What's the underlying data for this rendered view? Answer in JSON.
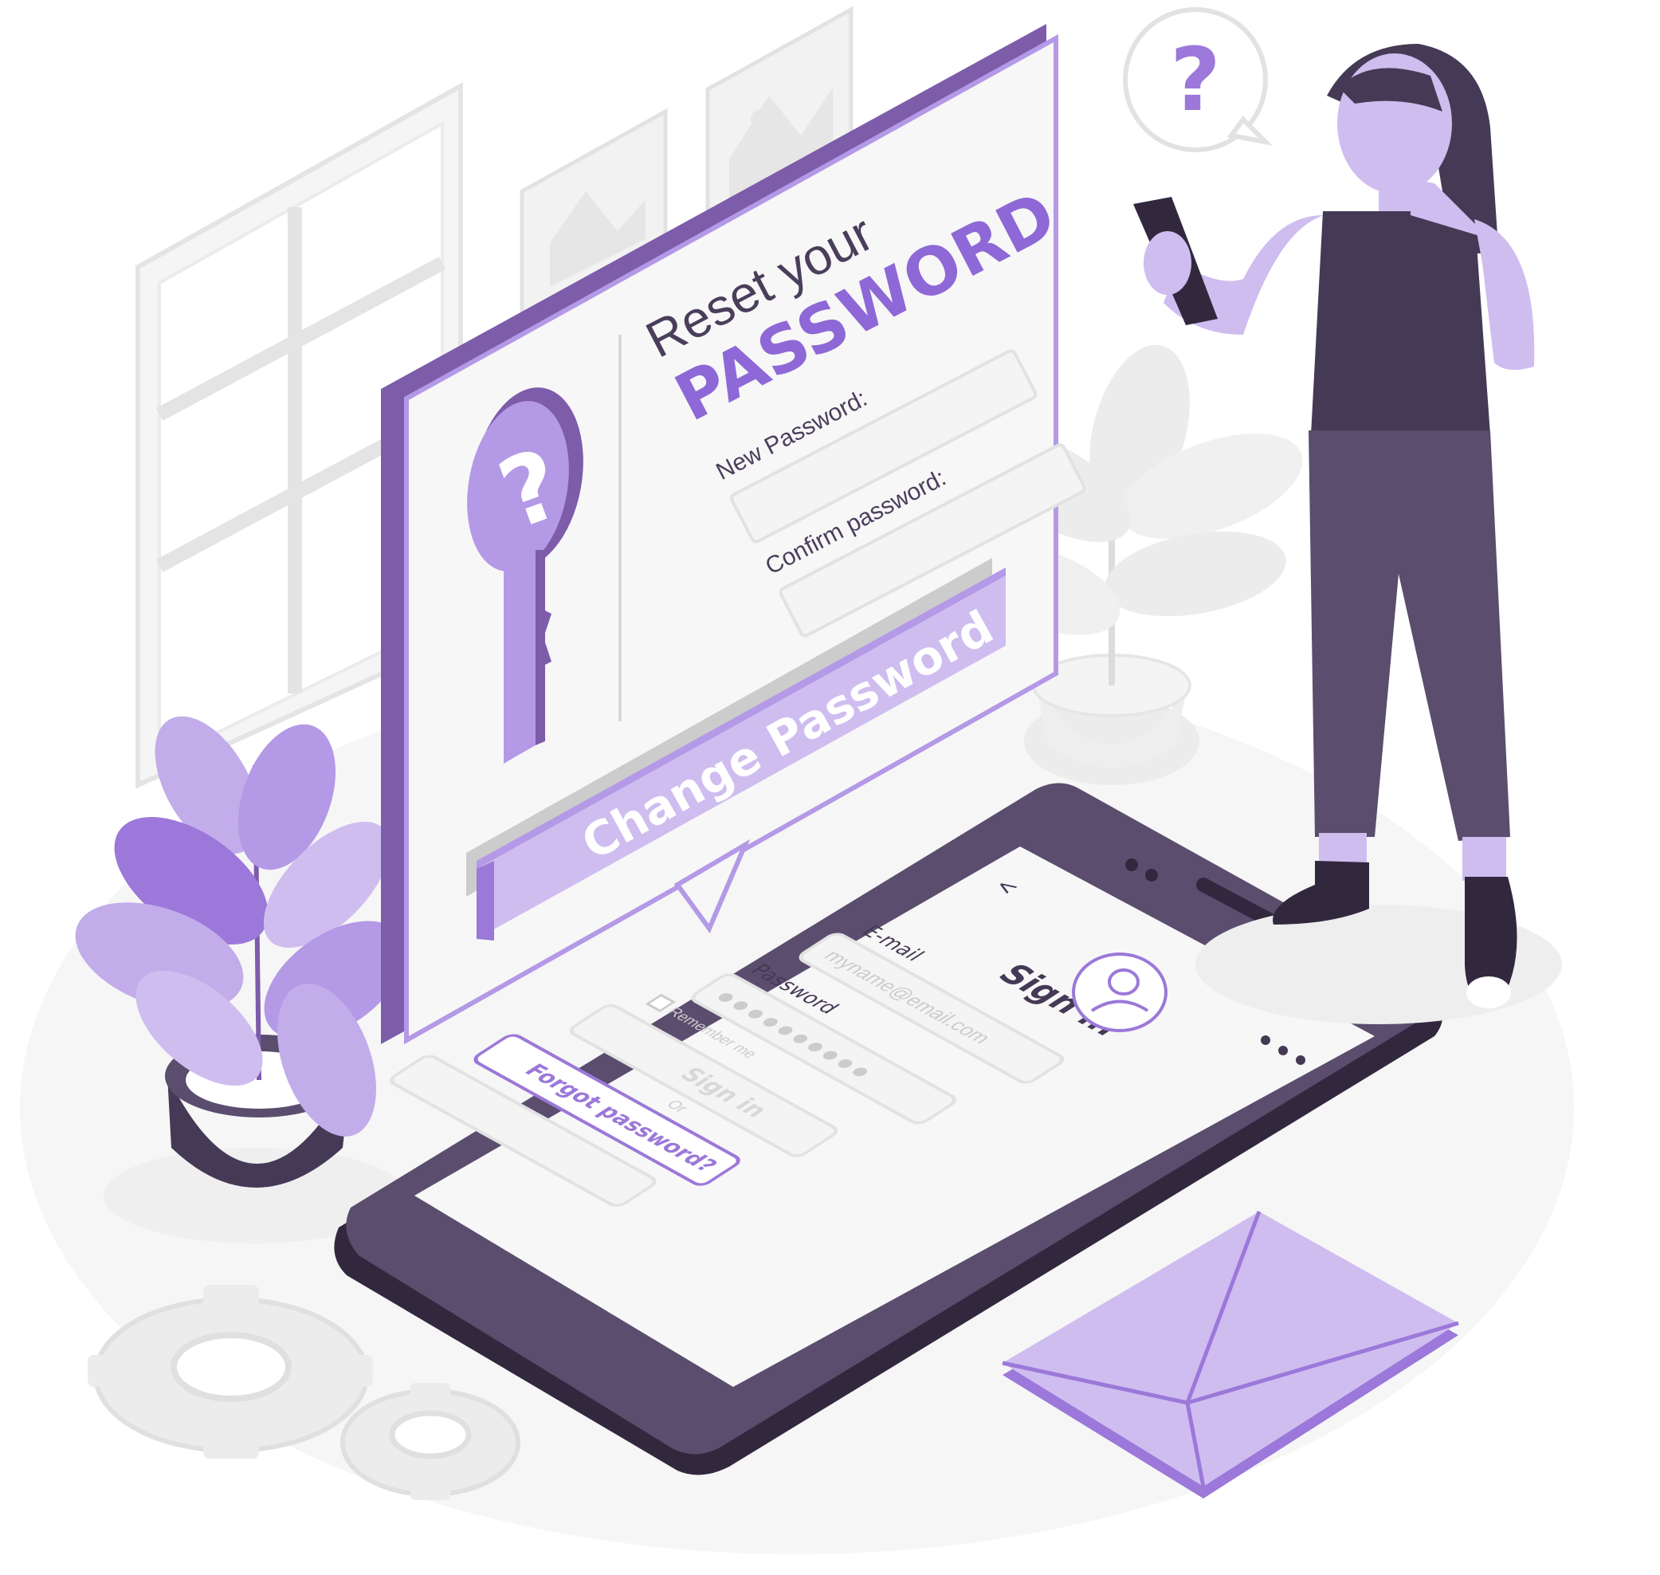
{
  "reset_card": {
    "title_line1": "Reset your",
    "title_line2": "PASSWORD",
    "new_password_label": "New Password:",
    "confirm_password_label": "Confirm password:",
    "change_button": "Change Password",
    "key_icon": "question-key-icon"
  },
  "phone_screen": {
    "back_icon": "<",
    "heading": "Sign in",
    "avatar_icon": "user-circle-icon",
    "menu_icon": "more-dots-icon",
    "email_label": "E-mail",
    "email_placeholder": "myname@email.com",
    "password_label": "Password",
    "password_mask": "● ● ● ● ● ● ● ● ● ●",
    "remember_me": "Remember me",
    "sign_in_button": "Sign in",
    "or_text": "Or",
    "forgot_password": "Forgot password?"
  },
  "speech_bubble": {
    "glyph": "?"
  },
  "colors": {
    "accent": "#9b78d9",
    "accent_light": "#cfbdf0",
    "accent_dark": "#7d5caa",
    "dark": "#453a55",
    "grey_light": "#f4f4f4",
    "grey_line": "#e2e2e2"
  }
}
